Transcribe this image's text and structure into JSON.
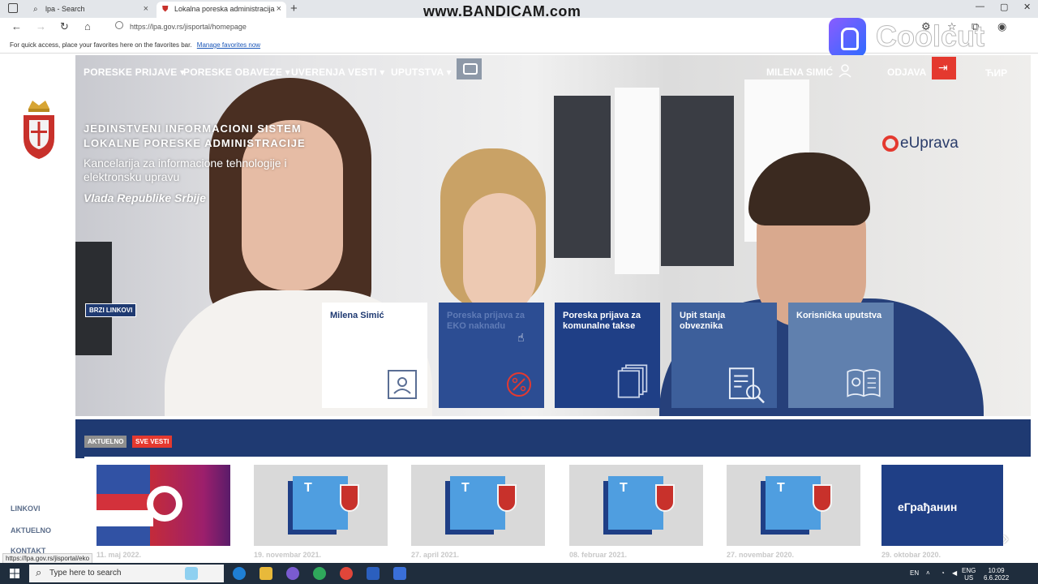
{
  "browser": {
    "tabs": [
      {
        "title": "lpa - Search",
        "icon": "search-icon"
      },
      {
        "title": "Lokalna poreska administracija",
        "icon": "crest-favicon"
      }
    ],
    "url": "https://lpa.gov.rs/jisportal/homepage",
    "favorites_hint": "For quick access, place your favorites here on the favorites bar.",
    "favorites_link": "Manage favorites now",
    "watermark": "www.BANDICAM.com",
    "overlay_brand": "Coolcut",
    "status_url": "https://lpa.gov.rs/jisportal/eko"
  },
  "nav": {
    "items": [
      "PORESKE PRIJAVE ▾",
      "PORESKE OBAVEZE ▾",
      "UVERENJA",
      "VESTI ▾",
      "UPUTSTVA ▾"
    ],
    "user": "MILENA SIMIĆ",
    "logout": "ODJAVA",
    "script_toggle": "ЋИР"
  },
  "hero": {
    "title_line1": "JEDINSTVENI INFORMACIONI SISTEM",
    "title_line2": "LOKALNE PORESKE ADMINISTRACIJE",
    "subtitle": "Kancelarija za informacione tehnologije i elektronsku upravu",
    "gov": "Vlada Republike Srbije",
    "euprava": "eUprava",
    "quick_links_label": "BRZI LINKOVI"
  },
  "tiles": [
    {
      "label": "Milena Simić",
      "icon": "user-card-icon"
    },
    {
      "label": "Poreska prijava za EKO naknadu",
      "icon": "percent-icon"
    },
    {
      "label": "Poreska prijava za komunalne takse",
      "icon": "documents-icon"
    },
    {
      "label": "Upit stanja obveznika",
      "icon": "document-search-icon"
    },
    {
      "label": "Korisnička uputstva",
      "icon": "manual-icon"
    }
  ],
  "news": {
    "chip_current": "AKTUELNO",
    "chip_all": "SVE VESTI",
    "cards": [
      {
        "date": "11. maj 2022.",
        "thumb": "eflag"
      },
      {
        "date": "19. novembar 2021.",
        "thumb": "doc"
      },
      {
        "date": "27. april 2021.",
        "thumb": "doc"
      },
      {
        "date": "08. februar 2021.",
        "thumb": "doc"
      },
      {
        "date": "27. novembar 2020.",
        "thumb": "doc"
      },
      {
        "date": "29. oktobar 2020.",
        "thumb": "egradjanin",
        "caption": "eГрађанин"
      }
    ]
  },
  "sidebar": {
    "links": [
      "LINKOVI",
      "AKTUELNO",
      "KONTAKT"
    ]
  },
  "taskbar": {
    "search_placeholder": "Type here to search",
    "lang": "EN",
    "kbd_line1": "ENG",
    "kbd_line2": "US",
    "time": "10:09",
    "date": "6.6.2022"
  },
  "colors": {
    "navy": "#1f3a72",
    "accent_red": "#e4392f"
  }
}
